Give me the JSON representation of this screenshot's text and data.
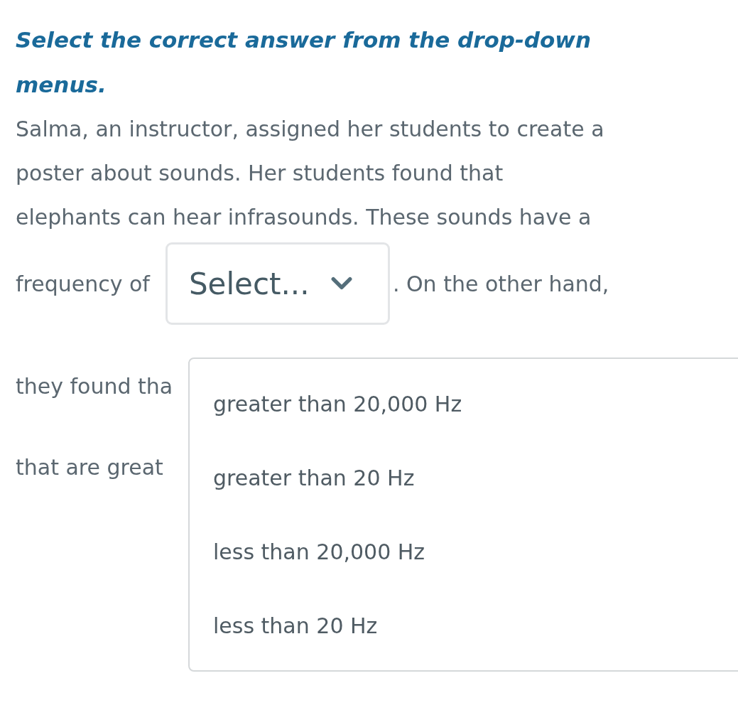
{
  "instruction": "Select the correct answer from the drop-down menus.",
  "passage_lines": [
    "Salma, an instructor, assigned her students to create a",
    "poster about sounds. Her students found that",
    "elephants can hear infrasounds. These sounds have a"
  ],
  "dropdown_line": {
    "before": "frequency of",
    "after": ". On the other hand,"
  },
  "dropdown": {
    "value": "Select...",
    "expanded": true,
    "options": [
      {
        "label": "greater than 20,000 Hz",
        "selected": false
      },
      {
        "label": "greater than 20 Hz",
        "selected": false
      },
      {
        "label": "less than 20,000 Hz",
        "selected": false
      },
      {
        "label": "less than 20 Hz",
        "selected": false
      }
    ]
  },
  "lines_after": [
    "they found tha",
    "that are great"
  ]
}
